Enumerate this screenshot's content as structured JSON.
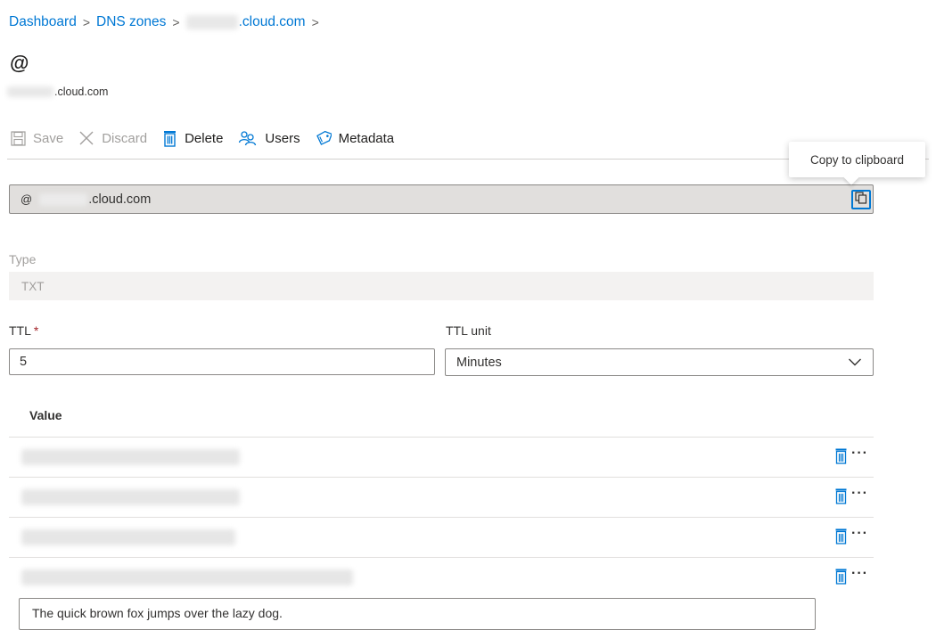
{
  "breadcrumb": {
    "items": [
      "Dashboard",
      "DNS zones",
      ".cloud.com"
    ],
    "separator": ">"
  },
  "page": {
    "title": "@",
    "subtitle": ".cloud.com"
  },
  "toolbar": {
    "save_label": "Save",
    "discard_label": "Discard",
    "delete_label": "Delete",
    "users_label": "Users",
    "metadata_label": "Metadata"
  },
  "tooltip": {
    "text": "Copy to clipboard"
  },
  "record_name": {
    "prefix": "@",
    "suffix": ".cloud.com"
  },
  "type": {
    "label": "Type",
    "value": "TXT"
  },
  "ttl": {
    "label": "TTL",
    "required_mark": "*",
    "value": "5",
    "unit_label": "TTL unit",
    "unit_value": "Minutes"
  },
  "values": {
    "header": "Value",
    "rows_count_redacted": 4,
    "new_value_input": "The quick brown fox jumps over the lazy dog."
  },
  "colors": {
    "accent": "#0078d4",
    "required": "#a4262c",
    "disabled_text": "#a19f9d"
  },
  "icons": {
    "save": "save-icon",
    "discard": "close-icon",
    "delete": "trash-icon",
    "users": "users-icon",
    "metadata": "tag-icon",
    "copy": "copy-icon",
    "chevron": "chevron-down-icon",
    "more": "more-icon"
  }
}
